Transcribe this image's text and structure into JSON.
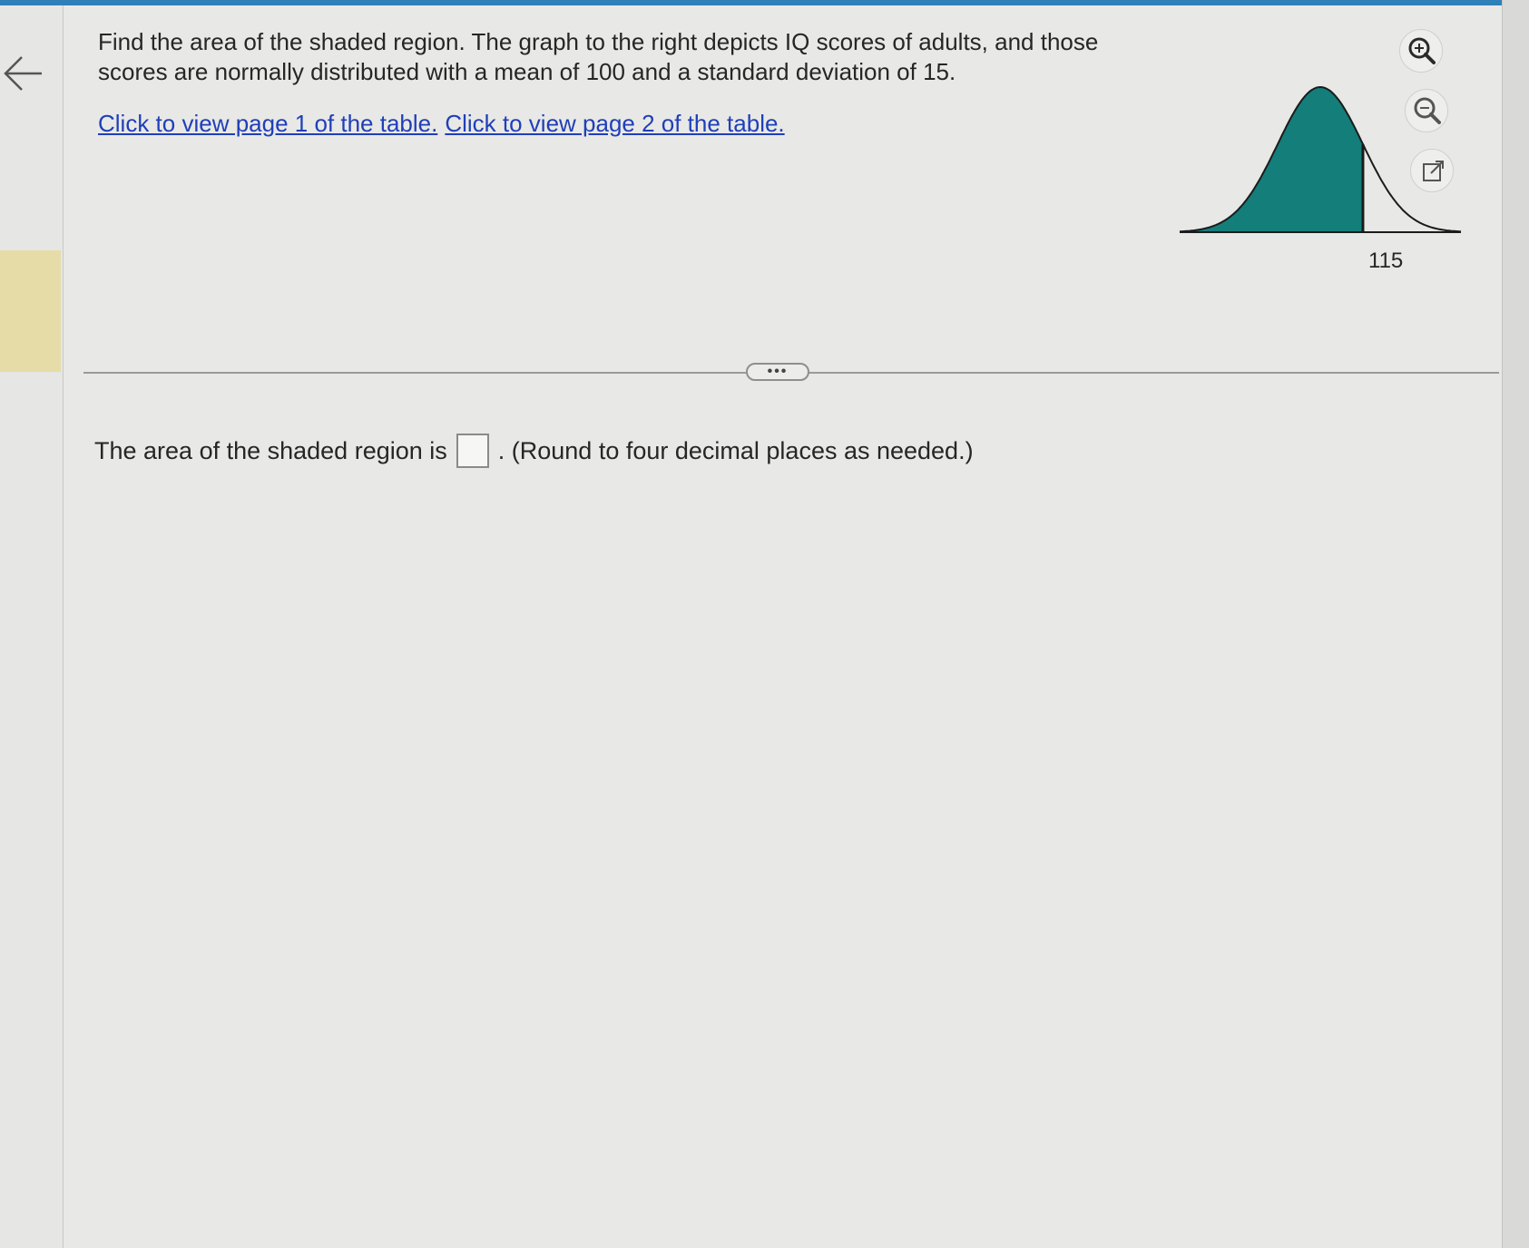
{
  "question": {
    "text": "Find the area of the shaded region. The graph to the right depicts IQ scores of adults, and those scores are normally distributed with a mean of 100 and a standard deviation of 15."
  },
  "links": {
    "page1": "Click to view page 1 of the table.",
    "page2": "Click to view page 2 of the table."
  },
  "graph": {
    "tick_label": "115",
    "shade_color": "#137e7a",
    "shaded_side": "left of 115"
  },
  "toolbar": {
    "zoom_in": "zoom-in-icon",
    "zoom_out": "zoom-out-icon",
    "popout": "popout-icon"
  },
  "divider": {
    "more_label": "•••"
  },
  "answer": {
    "prefix": "The area of the shaded region is",
    "value": "",
    "suffix": ". (Round to four decimal places as needed.)"
  },
  "colors": {
    "accent_bar": "#2f7fb8",
    "link": "#1f3fb8",
    "rail_highlight": "#e6dca8"
  }
}
